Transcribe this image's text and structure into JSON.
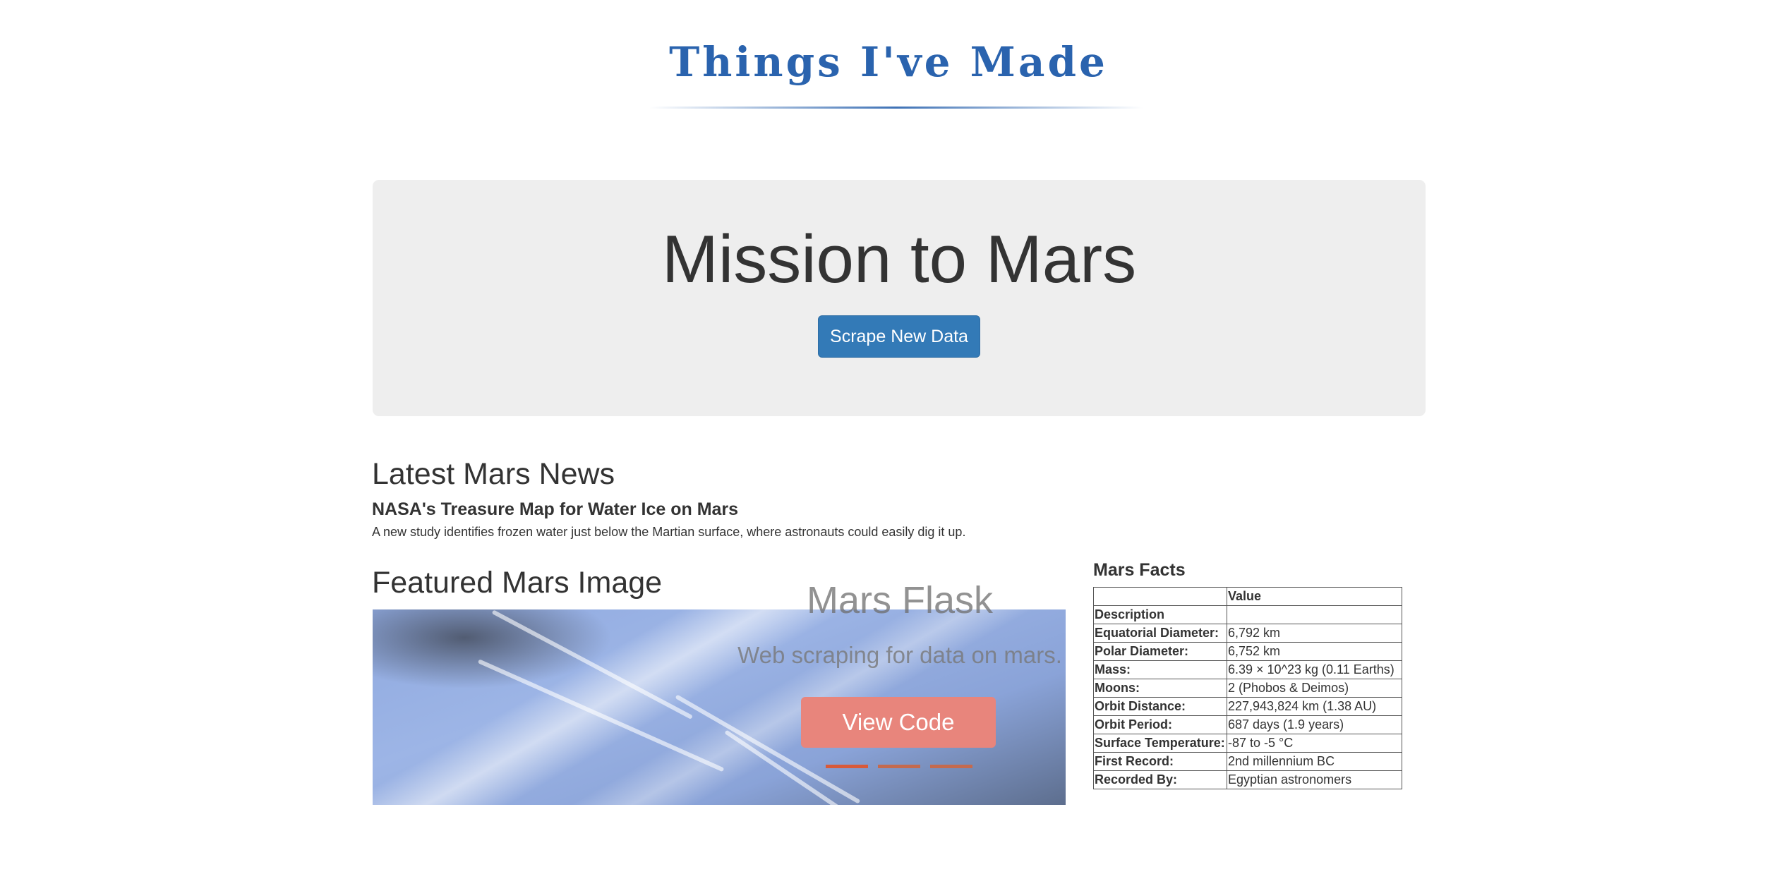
{
  "header": {
    "site_title": "Things I've Made",
    "accent_color": "#2a63ae"
  },
  "jumbotron": {
    "title": "Mission to Mars",
    "scrape_button_label": "Scrape New Data",
    "button_color": "#337ab7"
  },
  "news": {
    "heading": "Latest Mars News",
    "title": "NASA's Treasure Map for Water Ice on Mars",
    "teaser": "A new study identifies frozen water just below the Martian surface, where astronauts could easily dig it up."
  },
  "featured": {
    "heading": "Featured Mars Image"
  },
  "carousel": {
    "title": "Mars Flask",
    "subtitle": "Web scraping for data on mars.",
    "button_label": "View Code",
    "button_color": "#e8857c",
    "active_slide": 1,
    "slide_count": 3
  },
  "facts": {
    "heading": "Mars Facts",
    "header_row": [
      "",
      "Value"
    ],
    "index_label": "Description",
    "rows": [
      {
        "label": "Equatorial Diameter:",
        "value": "6,792 km"
      },
      {
        "label": "Polar Diameter:",
        "value": "6,752 km"
      },
      {
        "label": "Mass:",
        "value": "6.39 × 10^23 kg (0.11 Earths)"
      },
      {
        "label": "Moons:",
        "value": "2 (Phobos & Deimos)"
      },
      {
        "label": "Orbit Distance:",
        "value": "227,943,824 km (1.38 AU)"
      },
      {
        "label": "Orbit Period:",
        "value": "687 days (1.9 years)"
      },
      {
        "label": "Surface Temperature:",
        "value": "-87 to -5 °C"
      },
      {
        "label": "First Record:",
        "value": "2nd millennium BC"
      },
      {
        "label": "Recorded By:",
        "value": "Egyptian astronomers"
      }
    ]
  }
}
